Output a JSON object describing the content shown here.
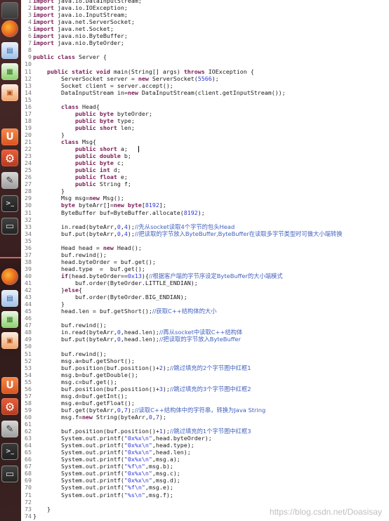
{
  "launcher": {
    "items": [
      {
        "name": "files-icon",
        "label": ""
      },
      {
        "name": "firefox-icon",
        "label": ""
      },
      {
        "name": "libreoffice-writer-icon",
        "label": ""
      },
      {
        "name": "libreoffice-calc-icon",
        "label": ""
      },
      {
        "name": "libreoffice-impress-icon",
        "label": ""
      },
      {
        "name": "ubuntu-software-icon",
        "label": "U"
      },
      {
        "name": "system-settings-icon",
        "label": "⚙"
      },
      {
        "name": "text-editor-icon",
        "label": "✎"
      },
      {
        "name": "terminal-icon",
        "label": ">_"
      },
      {
        "name": "screen-icon",
        "label": "▭"
      }
    ]
  },
  "editor": {
    "lines": [
      [
        [
          "kw",
          "import"
        ],
        [
          "src",
          " java.io.DataInputStream;"
        ]
      ],
      [
        [
          "kw",
          "import"
        ],
        [
          "src",
          " java.io.IOException;"
        ]
      ],
      [
        [
          "kw",
          "import"
        ],
        [
          "src",
          " java.io.InputStream;"
        ]
      ],
      [
        [
          "kw",
          "import"
        ],
        [
          "src",
          " java.net.ServerSocket;"
        ]
      ],
      [
        [
          "kw",
          "import"
        ],
        [
          "src",
          " java.net.Socket;"
        ]
      ],
      [
        [
          "kw",
          "import"
        ],
        [
          "src",
          " java.nio.ByteBuffer;"
        ]
      ],
      [
        [
          "kw",
          "import"
        ],
        [
          "src",
          " java.nio.ByteOrder;"
        ]
      ],
      [],
      [
        [
          "kw",
          "public class"
        ],
        [
          "src",
          " Server {"
        ]
      ],
      [],
      [
        [
          "src",
          "    "
        ],
        [
          "kw",
          "public static void"
        ],
        [
          "src",
          " main(String[] args) "
        ],
        [
          "kw",
          "throws"
        ],
        [
          "src",
          " IOException {"
        ]
      ],
      [
        [
          "src",
          "        ServerSocket server = "
        ],
        [
          "kw",
          "new"
        ],
        [
          "src",
          " ServerSocket("
        ],
        [
          "num",
          "5566"
        ],
        [
          "src",
          ");"
        ]
      ],
      [
        [
          "src",
          "        Socket client = server.accept();"
        ]
      ],
      [
        [
          "src",
          "        DataInputStream in="
        ],
        [
          "kw",
          "new"
        ],
        [
          "src",
          " DataInputStream(client.getInputStream());"
        ]
      ],
      [],
      [
        [
          "src",
          "        "
        ],
        [
          "kw",
          "class"
        ],
        [
          "src",
          " Head{"
        ]
      ],
      [
        [
          "src",
          "            "
        ],
        [
          "kw",
          "public byte"
        ],
        [
          "src",
          " byteOrder;"
        ]
      ],
      [
        [
          "src",
          "            "
        ],
        [
          "kw",
          "public byte"
        ],
        [
          "src",
          " type;"
        ]
      ],
      [
        [
          "src",
          "            "
        ],
        [
          "kw",
          "public short"
        ],
        [
          "src",
          " len;"
        ]
      ],
      [
        [
          "src",
          "        }"
        ]
      ],
      [
        [
          "src",
          "        "
        ],
        [
          "kw",
          "class"
        ],
        [
          "src",
          " Msg{"
        ]
      ],
      [
        [
          "src",
          "            "
        ],
        [
          "kw",
          "public short"
        ],
        [
          "src",
          " a;"
        ]
      ],
      [
        [
          "src",
          "            "
        ],
        [
          "kw",
          "public double"
        ],
        [
          "src",
          " b;"
        ]
      ],
      [
        [
          "src",
          "            "
        ],
        [
          "kw",
          "public byte"
        ],
        [
          "src",
          " c;"
        ]
      ],
      [
        [
          "src",
          "            "
        ],
        [
          "kw",
          "public int"
        ],
        [
          "src",
          " d;"
        ]
      ],
      [
        [
          "src",
          "            "
        ],
        [
          "kw",
          "public float"
        ],
        [
          "src",
          " e;"
        ]
      ],
      [
        [
          "src",
          "            "
        ],
        [
          "kw",
          "public"
        ],
        [
          "src",
          " String f;"
        ]
      ],
      [
        [
          "src",
          "        }"
        ]
      ],
      [
        [
          "src",
          "        Msg msg="
        ],
        [
          "kw",
          "new"
        ],
        [
          "src",
          " Msg();"
        ]
      ],
      [
        [
          "src",
          "        "
        ],
        [
          "kw",
          "byte"
        ],
        [
          "src",
          " byteArr[]="
        ],
        [
          "kw",
          "new byte"
        ],
        [
          "src",
          "["
        ],
        [
          "num",
          "8192"
        ],
        [
          "src",
          "];"
        ]
      ],
      [
        [
          "src",
          "        ByteBuffer buf=ByteBuffer.allocate("
        ],
        [
          "num",
          "8192"
        ],
        [
          "src",
          ");"
        ]
      ],
      [],
      [
        [
          "src",
          "        in.read(byteArr,"
        ],
        [
          "num",
          "0"
        ],
        [
          "src",
          ","
        ],
        [
          "num",
          "4"
        ],
        [
          "src",
          ");"
        ],
        [
          "cmt",
          "//先从socket读取4个字节的包头Head"
        ]
      ],
      [
        [
          "src",
          "        buf.put(byteArr,"
        ],
        [
          "num",
          "0"
        ],
        [
          "src",
          ","
        ],
        [
          "num",
          "4"
        ],
        [
          "src",
          ");"
        ],
        [
          "cmt",
          "//把读取的字节放入ByteBuffer,ByteBuffer在读取多字节类型时可做大小端转换"
        ]
      ],
      [],
      [
        [
          "src",
          "        Head head = "
        ],
        [
          "kw",
          "new"
        ],
        [
          "src",
          " Head();"
        ]
      ],
      [
        [
          "src",
          "        buf.rewind();"
        ]
      ],
      [
        [
          "src",
          "        head.byteOrder = buf.get();"
        ]
      ],
      [
        [
          "src",
          "        head.type  =  buf.get();"
        ]
      ],
      [
        [
          "src",
          "        "
        ],
        [
          "kw",
          "if"
        ],
        [
          "src",
          "(head.byteOrder=="
        ],
        [
          "num",
          "0x13"
        ],
        [
          "src",
          "){"
        ],
        [
          "cmt",
          "//根据客户端的字节序设定ByteBuffer的大小端模式"
        ]
      ],
      [
        [
          "src",
          "            buf.order(ByteOrder.LITTLE_ENDIAN);"
        ]
      ],
      [
        [
          "src",
          "        }"
        ],
        [
          "kw",
          "else"
        ],
        [
          "src",
          "{"
        ]
      ],
      [
        [
          "src",
          "            buf.order(ByteOrder.BIG_ENDIAN);"
        ]
      ],
      [
        [
          "src",
          "        }"
        ]
      ],
      [
        [
          "src",
          "        head.len = buf.getShort();"
        ],
        [
          "cmt",
          "//获取C++结构体的大小"
        ]
      ],
      [],
      [
        [
          "src",
          "        buf.rewind();"
        ]
      ],
      [
        [
          "src",
          "        in.read(byteArr,"
        ],
        [
          "num",
          "0"
        ],
        [
          "src",
          ",head.len);"
        ],
        [
          "cmt",
          "//再从socket中读取C++结构体"
        ]
      ],
      [
        [
          "src",
          "        buf.put(byteArr,"
        ],
        [
          "num",
          "0"
        ],
        [
          "src",
          ",head.len);"
        ],
        [
          "cmt",
          "//把读取的字节放入ByteBuffer"
        ]
      ],
      [],
      [
        [
          "src",
          "        buf.rewind();"
        ]
      ],
      [
        [
          "src",
          "        msg.a=buf.getShort();"
        ]
      ],
      [
        [
          "src",
          "        buf.position(buf.position()+"
        ],
        [
          "num",
          "2"
        ],
        [
          "src",
          ");"
        ],
        [
          "cmt",
          "//跳过填充的2个字节图中红框1"
        ]
      ],
      [
        [
          "src",
          "        msg.b=buf.getDouble();"
        ]
      ],
      [
        [
          "src",
          "        msg.c=buf.get();"
        ]
      ],
      [
        [
          "src",
          "        buf.position(buf.position()+"
        ],
        [
          "num",
          "3"
        ],
        [
          "src",
          ");"
        ],
        [
          "cmt",
          "//跳过填充的3个字节图中红框2"
        ]
      ],
      [
        [
          "src",
          "        msg.d=buf.getInt();"
        ]
      ],
      [
        [
          "src",
          "        msg.e=buf.getFloat();"
        ]
      ],
      [
        [
          "src",
          "        buf.get(byteArr,"
        ],
        [
          "num",
          "0"
        ],
        [
          "src",
          ","
        ],
        [
          "num",
          "7"
        ],
        [
          "src",
          ");"
        ],
        [
          "cmt",
          "//读取C++结构体中的字符串，转换为Java String"
        ]
      ],
      [
        [
          "src",
          "        msg.f="
        ],
        [
          "kw",
          "new"
        ],
        [
          "src",
          " String(byteArr,"
        ],
        [
          "num",
          "0"
        ],
        [
          "src",
          ","
        ],
        [
          "num",
          "7"
        ],
        [
          "src",
          ");"
        ]
      ],
      [],
      [
        [
          "src",
          "        buf.position(buf.position()+"
        ],
        [
          "num",
          "1"
        ],
        [
          "src",
          ");"
        ],
        [
          "cmt",
          "//跳过填充的1个字节图中红框3"
        ]
      ],
      [
        [
          "src",
          "        System.out.printf("
        ],
        [
          "str",
          "\"0x%x\\n\""
        ],
        [
          "src",
          ",head.byteOrder);"
        ]
      ],
      [
        [
          "src",
          "        System.out.printf("
        ],
        [
          "str",
          "\"0x%x\\n\""
        ],
        [
          "src",
          ",head.type);"
        ]
      ],
      [
        [
          "src",
          "        System.out.printf("
        ],
        [
          "str",
          "\"0x%x\\n\""
        ],
        [
          "src",
          ",head.len);"
        ]
      ],
      [
        [
          "src",
          "        System.out.printf("
        ],
        [
          "str",
          "\"0x%x\\n\""
        ],
        [
          "src",
          ",msg.a);"
        ]
      ],
      [
        [
          "src",
          "        System.out.printf("
        ],
        [
          "str",
          "\"%f\\n\""
        ],
        [
          "src",
          ",msg.b);"
        ]
      ],
      [
        [
          "src",
          "        System.out.printf("
        ],
        [
          "str",
          "\"0x%x\\n\""
        ],
        [
          "src",
          ",msg.c);"
        ]
      ],
      [
        [
          "src",
          "        System.out.printf("
        ],
        [
          "str",
          "\"0x%x\\n\""
        ],
        [
          "src",
          ",msg.d);"
        ]
      ],
      [
        [
          "src",
          "        System.out.printf("
        ],
        [
          "str",
          "\"%f\\n\""
        ],
        [
          "src",
          ",msg.e);"
        ]
      ],
      [
        [
          "src",
          "        System.out.printf("
        ],
        [
          "str",
          "\"%s\\n\""
        ],
        [
          "src",
          ",msg.f);"
        ]
      ],
      [],
      [
        [
          "src",
          "    }"
        ]
      ],
      [
        [
          "src",
          "}"
        ]
      ]
    ]
  },
  "watermark": "https://blog.csdn.net/Doasisay"
}
